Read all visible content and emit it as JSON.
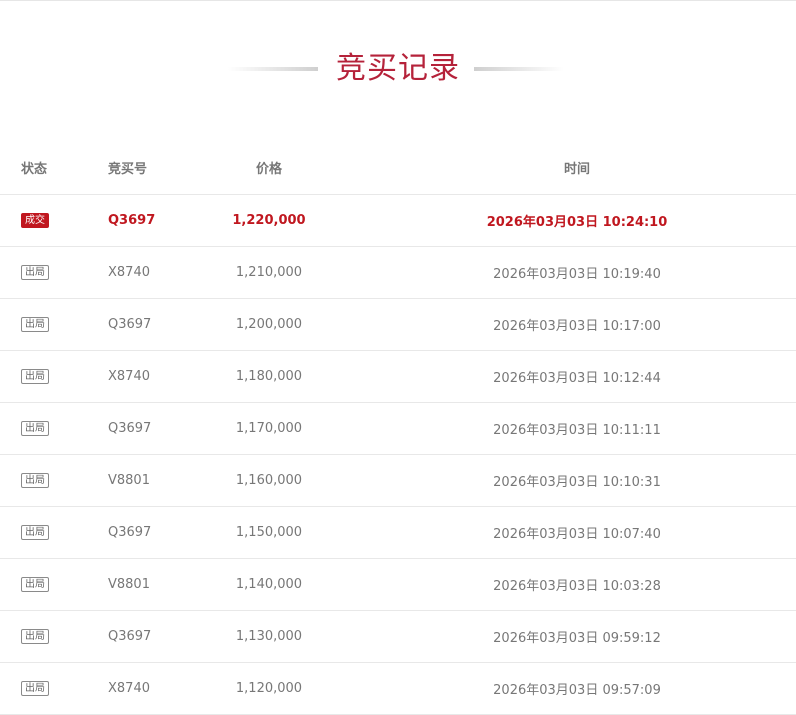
{
  "page": {
    "title": "竞买记录"
  },
  "table": {
    "headers": {
      "status": "状态",
      "bid_no": "竞买号",
      "price": "价格",
      "time": "时间"
    },
    "rows": [
      {
        "status": "成交",
        "bid_no": "Q3697",
        "price": "1,220,000",
        "time": "2026年03月03日 10:24:10"
      },
      {
        "status": "出局",
        "bid_no": "X8740",
        "price": "1,210,000",
        "time": "2026年03月03日 10:19:40"
      },
      {
        "status": "出局",
        "bid_no": "Q3697",
        "price": "1,200,000",
        "time": "2026年03月03日 10:17:00"
      },
      {
        "status": "出局",
        "bid_no": "X8740",
        "price": "1,180,000",
        "time": "2026年03月03日 10:12:44"
      },
      {
        "status": "出局",
        "bid_no": "Q3697",
        "price": "1,170,000",
        "time": "2026年03月03日 10:11:11"
      },
      {
        "status": "出局",
        "bid_no": "V8801",
        "price": "1,160,000",
        "time": "2026年03月03日 10:10:31"
      },
      {
        "status": "出局",
        "bid_no": "Q3697",
        "price": "1,150,000",
        "time": "2026年03月03日 10:07:40"
      },
      {
        "status": "出局",
        "bid_no": "V8801",
        "price": "1,140,000",
        "time": "2026年03月03日 10:03:28"
      },
      {
        "status": "出局",
        "bid_no": "Q3697",
        "price": "1,130,000",
        "time": "2026年03月03日 09:59:12"
      },
      {
        "status": "出局",
        "bid_no": "X8740",
        "price": "1,120,000",
        "time": "2026年03月03日 09:57:09"
      }
    ]
  },
  "colors": {
    "accent": "#c0171f",
    "title": "#b5223a",
    "text": "#777777",
    "divider": "#e8e8e8"
  }
}
